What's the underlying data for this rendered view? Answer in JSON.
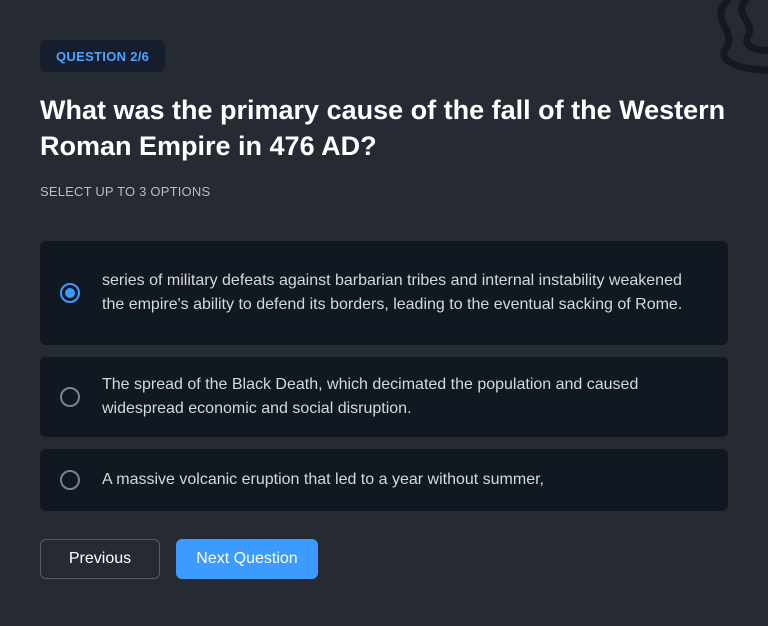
{
  "quiz": {
    "progress_label": "QUESTION 2/6",
    "question": "What was the primary cause of the fall of the Western Roman Empire in 476 AD?",
    "hint": "SELECT UP TO 3 OPTIONS",
    "options": [
      {
        "text": "series of military defeats against barbarian tribes and internal instability weakened the empire's ability to defend its borders, leading to the eventual sacking of Rome.",
        "selected": true
      },
      {
        "text": "The spread of the Black Death, which decimated the population and caused widespread economic and social disruption.",
        "selected": false
      },
      {
        "text": "A massive volcanic eruption that led to a year without summer,",
        "selected": false
      }
    ]
  },
  "actions": {
    "previous_label": "Previous",
    "next_label": "Next Question"
  },
  "colors": {
    "background": "#252a33",
    "card": "#121821",
    "accent": "#3d9bff",
    "badge_bg": "#161d2c"
  },
  "icons": {
    "decoration": "squiggle-decoration-icon",
    "radio_selected": "radio-selected-icon",
    "radio_unselected": "radio-unselected-icon"
  }
}
